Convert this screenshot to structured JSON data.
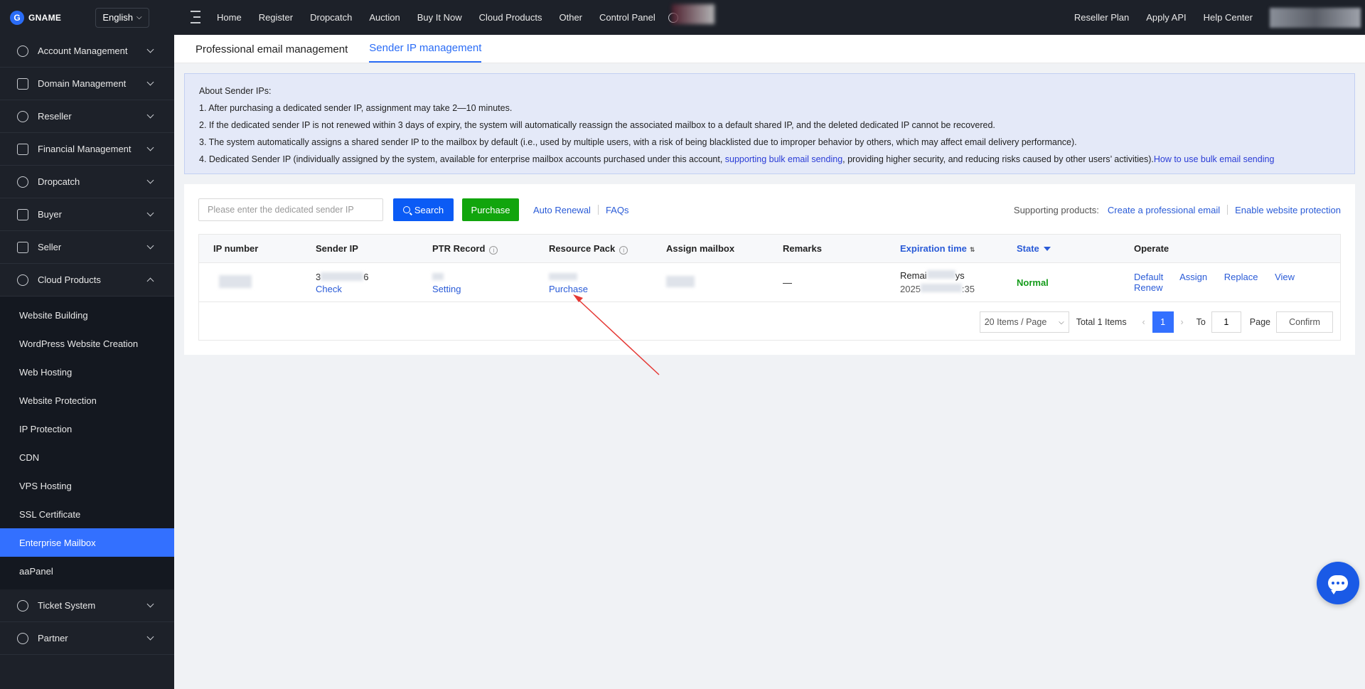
{
  "brand": {
    "name": "GNAME",
    "logo_letter": "G"
  },
  "topbar": {
    "language": "English",
    "nav": [
      "Home",
      "Register",
      "Dropcatch",
      "Auction",
      "Buy It Now",
      "Cloud Products",
      "Other",
      "Control Panel"
    ],
    "right_links": [
      "Reseller Plan",
      "Apply API",
      "Help Center"
    ]
  },
  "sidebar": {
    "groups_top": [
      {
        "label": "Account Management",
        "icon": "user-icon"
      },
      {
        "label": "Domain Management",
        "icon": "layers-icon"
      },
      {
        "label": "Reseller",
        "icon": "reseller-icon"
      },
      {
        "label": "Financial Management",
        "icon": "dollar-icon"
      },
      {
        "label": "Dropcatch",
        "icon": "clock-icon"
      },
      {
        "label": "Buyer",
        "icon": "cart-icon"
      },
      {
        "label": "Seller",
        "icon": "store-icon"
      },
      {
        "label": "Cloud Products",
        "icon": "cloud-icon"
      }
    ],
    "cloud_sub": [
      "Website Building",
      "WordPress Website Creation",
      "Web Hosting",
      "Website Protection",
      "IP Protection",
      "CDN",
      "VPS Hosting",
      "SSL Certificate",
      "Enterprise Mailbox",
      "aaPanel"
    ],
    "active_sub": "Enterprise Mailbox",
    "groups_bottom": [
      {
        "label": "Ticket System",
        "icon": "ticket-icon"
      },
      {
        "label": "Partner",
        "icon": "partner-icon"
      }
    ]
  },
  "tabs": {
    "t1": "Professional email management",
    "t2": "Sender IP management"
  },
  "notice": {
    "title": "About Sender IPs:",
    "line1": "1. After purchasing a dedicated sender IP, assignment may take 2—10 minutes.",
    "line2": "2. If the dedicated sender IP is not renewed within 3 days of expiry, the system will automatically reassign the associated mailbox to a default shared IP, and the deleted dedicated IP cannot be recovered.",
    "line3": "3. The system automatically assigns a shared sender IP to the mailbox by default (i.e., used by multiple users, with a risk of being blacklisted due to improper behavior by others, which may affect email delivery performance).",
    "line4_a": "4. Dedicated Sender IP (individually assigned by the system, available for enterprise mailbox accounts purchased under this account, ",
    "line4_link": "supporting bulk email sending",
    "line4_b": ", providing higher security, and reducing risks caused by other users’ activities).",
    "line4_link2": "How to use bulk email sending"
  },
  "toolbar": {
    "search_placeholder": "Please enter the dedicated sender IP",
    "search_label": "Search",
    "purchase_label": "Purchase",
    "auto_renewal": "Auto Renewal",
    "faqs": "FAQs",
    "supporting": "Supporting products:",
    "create_email": "Create a professional email",
    "enable_protection": "Enable website protection"
  },
  "table": {
    "headers": {
      "ip": "IP number",
      "sender": "Sender IP",
      "ptr": "PTR Record",
      "pack": "Resource Pack",
      "assign": "Assign mailbox",
      "remarks": "Remarks",
      "expiration": "Expiration time",
      "state": "State",
      "operate": "Operate"
    },
    "row": {
      "sender_partial_a": "3",
      "sender_partial_b": "6",
      "sender_action": "Check",
      "ptr_action": "Setting",
      "pack_action": "Purchase",
      "remarks": "—",
      "exp_line1_a": "Remai",
      "exp_line1_b": "ys",
      "exp_line2_a": "2025",
      "exp_line2_b": ":35",
      "state": "Normal",
      "ops": [
        "Default",
        "Assign",
        "Replace",
        "View",
        "Renew"
      ]
    }
  },
  "pager": {
    "page_size": "20 Items / Page",
    "total": "Total 1 Items",
    "current": "1",
    "to": "To",
    "goto_value": "1",
    "page": "Page",
    "confirm": "Confirm"
  },
  "colors": {
    "accent": "#2a6cf6",
    "active_sidebar": "#3370ff",
    "success": "#149b1a",
    "annotation_arrow": "#e53935"
  }
}
